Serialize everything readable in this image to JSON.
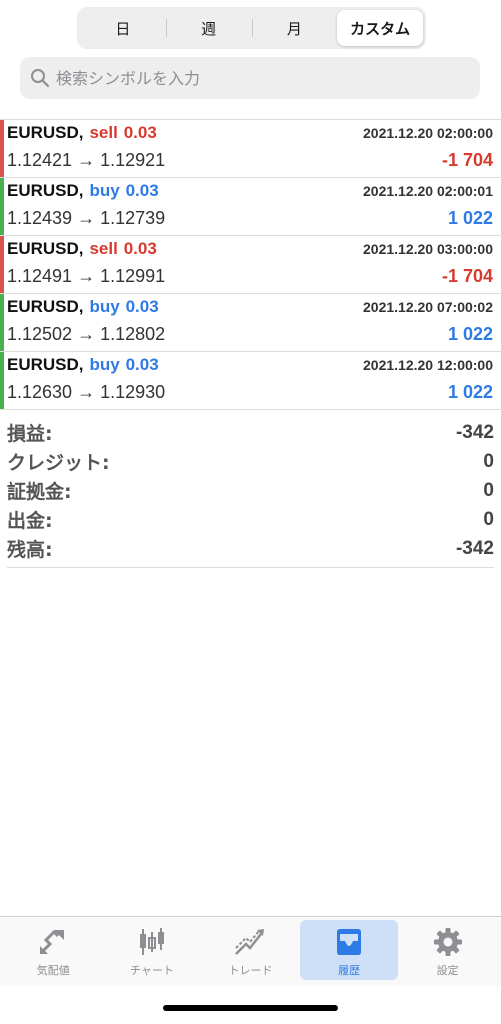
{
  "period_tabs": [
    {
      "label": "日",
      "active": false
    },
    {
      "label": "週",
      "active": false
    },
    {
      "label": "月",
      "active": false
    },
    {
      "label": "カスタム",
      "active": true
    }
  ],
  "search": {
    "placeholder": "検索シンボルを入力"
  },
  "colors": {
    "sell": "#d63a2f",
    "buy": "#2f7be5",
    "bar_sell": "#d9534f",
    "bar_buy": "#4caf50"
  },
  "deals": [
    {
      "symbol": "EURUSD,",
      "side": "sell",
      "volume": "0.03",
      "time": "2021.12.20 02:00:00",
      "prices": "1.12421 → 1.12921",
      "profit": "-1 704"
    },
    {
      "symbol": "EURUSD,",
      "side": "buy",
      "volume": "0.03",
      "time": "2021.12.20 02:00:01",
      "prices": "1.12439 → 1.12739",
      "profit": "1 022"
    },
    {
      "symbol": "EURUSD,",
      "side": "sell",
      "volume": "0.03",
      "time": "2021.12.20 03:00:00",
      "prices": "1.12491 → 1.12991",
      "profit": "-1 704"
    },
    {
      "symbol": "EURUSD,",
      "side": "buy",
      "volume": "0.03",
      "time": "2021.12.20 07:00:02",
      "prices": "1.12502 → 1.12802",
      "profit": "1 022"
    },
    {
      "symbol": "EURUSD,",
      "side": "buy",
      "volume": "0.03",
      "time": "2021.12.20 12:00:00",
      "prices": "1.12630 → 1.12930",
      "profit": "1 022"
    }
  ],
  "summary": [
    {
      "label": "損益:",
      "value": "-342"
    },
    {
      "label": "クレジット:",
      "value": "0"
    },
    {
      "label": "証拠金:",
      "value": "0"
    },
    {
      "label": "出金:",
      "value": "0"
    },
    {
      "label": "残高:",
      "value": "-342"
    }
  ],
  "tabbar": [
    {
      "label": "気配値",
      "icon": "quotes-icon",
      "active": false
    },
    {
      "label": "チャート",
      "icon": "chart-icon",
      "active": false
    },
    {
      "label": "トレード",
      "icon": "trade-icon",
      "active": false
    },
    {
      "label": "履歴",
      "icon": "history-icon",
      "active": true
    },
    {
      "label": "設定",
      "icon": "settings-icon",
      "active": false
    }
  ]
}
